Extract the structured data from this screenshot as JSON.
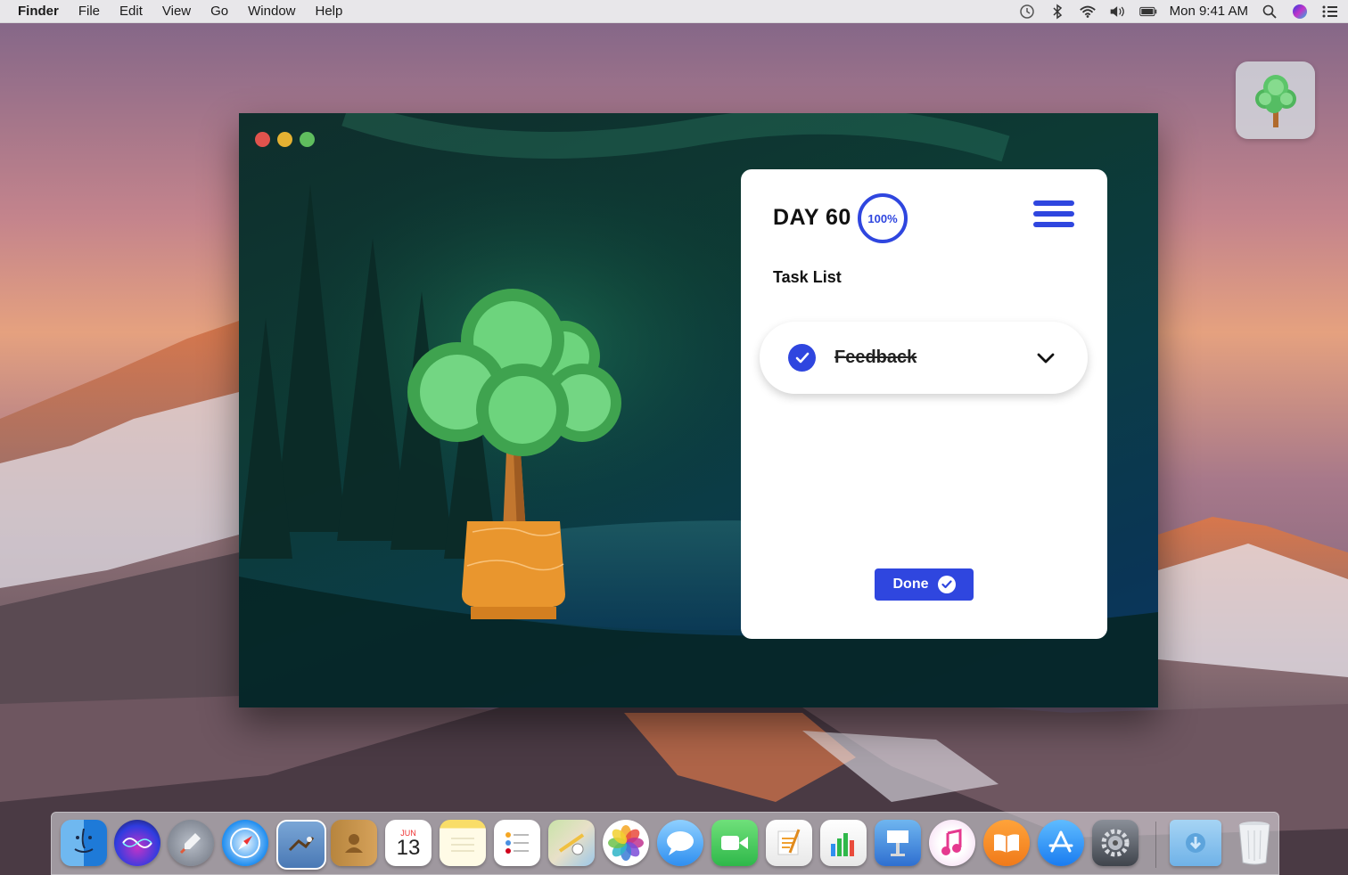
{
  "menubar": {
    "app_name": "Finder",
    "items": [
      "File",
      "Edit",
      "View",
      "Go",
      "Window",
      "Help"
    ],
    "clock": "Mon 9:41 AM",
    "tray_icons": [
      "time-machine-icon",
      "bluetooth-icon",
      "wifi-icon",
      "volume-icon",
      "battery-icon",
      "spotlight-icon",
      "siri-icon",
      "notification-center-icon"
    ]
  },
  "widget": {
    "icon": "tree-icon"
  },
  "card": {
    "day_label": "DAY 60",
    "progress_label": "100%",
    "progress": 1.0,
    "section_title": "Task List",
    "tasks": [
      {
        "label": "Feedback",
        "completed": true
      }
    ],
    "done_label": "Done"
  },
  "colors": {
    "accent": "#2f46df",
    "window_bg": "#0d3a34",
    "tree_green": "#5cc56a",
    "pot_orange": "#e9962e"
  },
  "dock": {
    "apps": [
      "finder-icon",
      "siri-icon",
      "launchpad-icon",
      "safari-icon",
      "mail-icon",
      "contacts-icon",
      "calendar-icon",
      "notes-icon",
      "reminders-icon",
      "maps-icon",
      "photos-icon",
      "messages-icon",
      "facetime-icon",
      "pages-icon",
      "numbers-icon",
      "keynote-icon",
      "itunes-icon",
      "ibooks-icon",
      "app-store-icon",
      "system-preferences-icon",
      "downloads-folder-icon",
      "trash-icon"
    ],
    "calendar_month": "JUN",
    "calendar_day": "13"
  }
}
